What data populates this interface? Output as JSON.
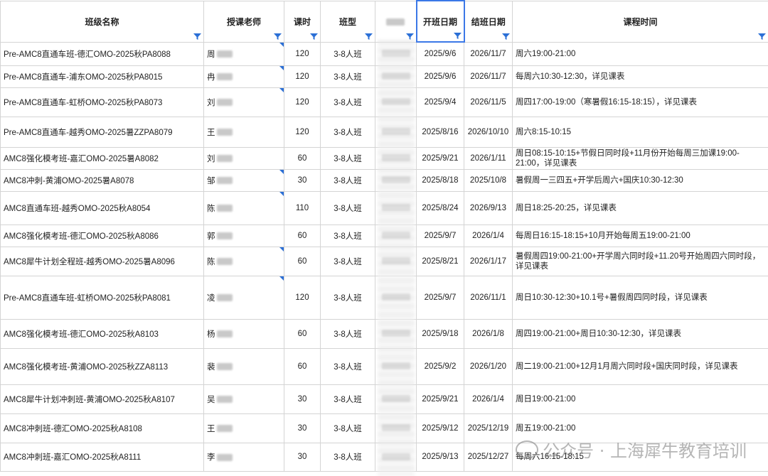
{
  "headers": [
    "班级名称",
    "授课老师",
    "课时",
    "班型",
    "",
    "开班日期",
    "结班日期",
    "课程时间"
  ],
  "rows": [
    {
      "name": "Pre-AMC8直通车班-德汇OMO-2025秋PA8088",
      "teacher": "周",
      "hours": "120",
      "type": "3-8人班",
      "start": "2025/9/6",
      "end": "2026/11/7",
      "time": "周六19:00-21:00"
    },
    {
      "name": "Pre-AMC8直通车-浦东OMO-2025秋PA8015",
      "teacher": "冉",
      "hours": "120",
      "type": "3-8人班",
      "start": "2025/9/6",
      "end": "2026/11/7",
      "time": "每周六10:30-12:30，详见课表"
    },
    {
      "name": "Pre-AMC8直通车-虹桥OMO-2025秋PA8073",
      "teacher": "刘",
      "hours": "120",
      "type": "3-8人班",
      "start": "2025/9/4",
      "end": "2026/11/5",
      "time": "周四17:00-19:00（寒暑假16:15-18:15），详见课表"
    },
    {
      "name": "Pre-AMC8直通车-越秀OMO-2025暑ZZPA8079",
      "teacher": "王",
      "hours": "120",
      "type": "3-8人班",
      "start": "2025/8/16",
      "end": "2026/10/10",
      "time": "周六8:15-10:15"
    },
    {
      "name": "AMC8强化模考班-嘉汇OMO-2025暑A8082",
      "teacher": "刘",
      "hours": "60",
      "type": "3-8人班",
      "start": "2025/9/21",
      "end": "2026/1/11",
      "time": "周日08:15-10:15+节假日同时段+11月份开始每周三加课19:00-21:00，详见课表"
    },
    {
      "name": "AMC8冲刺-黄浦OMO-2025暑A8078",
      "teacher": "邹",
      "hours": "30",
      "type": "3-8人班",
      "start": "2025/8/18",
      "end": "2025/10/8",
      "time": "暑假周一三四五+开学后周六+国庆10:30-12:30"
    },
    {
      "name": "AMC8直通车班-越秀OMO-2025秋A8054",
      "teacher": "陈",
      "hours": "110",
      "type": "3-8人班",
      "start": "2025/8/24",
      "end": "2026/9/13",
      "time": "周日18:25-20:25，详见课表"
    },
    {
      "name": "AMC8强化模考班-德汇OMO-2025秋A8086",
      "teacher": "郭",
      "hours": "60",
      "type": "3-8人班",
      "start": "2025/9/7",
      "end": "2026/1/4",
      "time": "每周日16:15-18:15+10月开始每周五19:00-21:00"
    },
    {
      "name": "AMC8犀牛计划全程班-越秀OMO-2025暑A8096",
      "teacher": "陈",
      "hours": "60",
      "type": "3-8人班",
      "start": "2025/8/21",
      "end": "2026/1/17",
      "time": "暑假周四19:00-21:00+开学周六同时段+11.20号开始周四六同时段，详见课表"
    },
    {
      "name": "Pre-AMC8直通车班-虹桥OMO-2025秋PA8081",
      "teacher": "凌",
      "hours": "120",
      "type": "3-8人班",
      "start": "2025/9/7",
      "end": "2026/11/1",
      "time": "周日10:30-12:30+10.1号+暑假周四同时段，详见课表"
    },
    {
      "name": "AMC8强化模考班-德汇OMO-2025秋A8103",
      "teacher": "杨",
      "hours": "60",
      "type": "3-8人班",
      "start": "2025/9/18",
      "end": "2026/1/8",
      "time": "周四19:00-21:00+周日10:30-12:30，详见课表"
    },
    {
      "name": "AMC8强化模考班-黄浦OMO-2025秋ZZA8113",
      "teacher": "裴",
      "hours": "60",
      "type": "3-8人班",
      "start": "2025/9/2",
      "end": "2026/1/20",
      "time": "周二19:00-21:00+12月1月周六同时段+国庆同时段，详见课表"
    },
    {
      "name": "AMC8犀牛计划冲刺班-黄浦OMO-2025秋A8107",
      "teacher": "吴",
      "hours": "30",
      "type": "3-8人班",
      "start": "2025/9/21",
      "end": "2026/1/4",
      "time": "周日19:00-21:00"
    },
    {
      "name": "AMC8冲刺班-德汇OMO-2025秋A8108",
      "teacher": "王",
      "hours": "30",
      "type": "3-8人班",
      "start": "2025/9/12",
      "end": "2025/12/19",
      "time": "周五19:00-21:00"
    },
    {
      "name": "AMC8冲刺班-嘉汇OMO-2025秋A8111",
      "teacher": "李",
      "hours": "30",
      "type": "3-8人班",
      "start": "2025/9/13",
      "end": "2025/12/27",
      "time": "每周六16:15-18:15"
    }
  ],
  "watermark": "公众号 · 上海犀牛教育培训",
  "colors": {
    "accent": "#3b78e7",
    "filter": "#2b6fd6"
  }
}
